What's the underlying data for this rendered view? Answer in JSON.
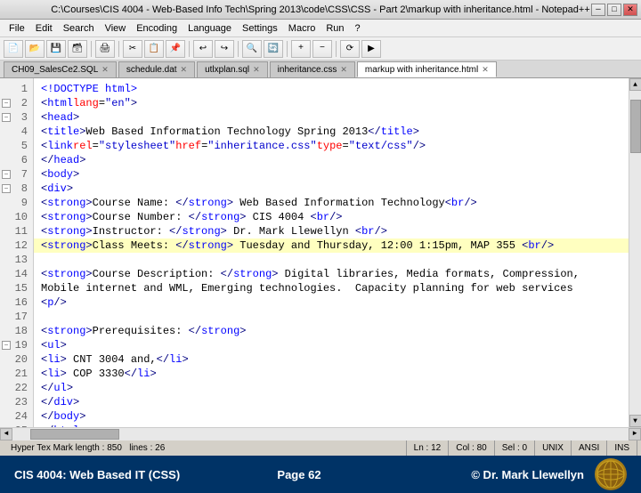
{
  "titleBar": {
    "text": "C:\\Courses\\CIS 4004 - Web-Based Info Tech\\Spring 2013\\code\\CSS\\CSS - Part 2\\markup with inheritance.html - Notepad++",
    "closeBtn": "✕",
    "maxBtn": "□",
    "minBtn": "─"
  },
  "menuBar": {
    "items": [
      "File",
      "Edit",
      "Search",
      "View",
      "Encoding",
      "Language",
      "Settings",
      "Macro",
      "Run",
      "?"
    ]
  },
  "tabs": [
    {
      "label": "CH09_SalesCe2.SQL",
      "active": false
    },
    {
      "label": "schedule.dat",
      "active": false
    },
    {
      "label": "utlxplan.sql",
      "active": false
    },
    {
      "label": "inheritance.css",
      "active": false
    },
    {
      "label": "markup with inheritance.html",
      "active": true
    }
  ],
  "lines": [
    {
      "num": 1,
      "indent": 0,
      "content": "<!DOCTYPE html>",
      "fold": false,
      "highlight": false
    },
    {
      "num": 2,
      "indent": 0,
      "content": "<html lang=\"en\">",
      "fold": true,
      "highlight": false
    },
    {
      "num": 3,
      "indent": 1,
      "content": "<head>",
      "fold": true,
      "highlight": false
    },
    {
      "num": 4,
      "indent": 2,
      "content": "<title>Web Based Information Technology Spring 2013</title>",
      "fold": false,
      "highlight": false
    },
    {
      "num": 5,
      "indent": 2,
      "content": "<link rel=\"stylesheet\" href=\"inheritance.css\" type=\"text/css\"  />",
      "fold": false,
      "highlight": false
    },
    {
      "num": 6,
      "indent": 1,
      "content": "</head>",
      "fold": false,
      "highlight": false
    },
    {
      "num": 7,
      "indent": 1,
      "content": "<body>",
      "fold": true,
      "highlight": false
    },
    {
      "num": 8,
      "indent": 2,
      "content": "<div>",
      "fold": true,
      "highlight": false
    },
    {
      "num": 9,
      "indent": 3,
      "content": "<strong>Course Name: </strong> Web Based Information Technology<br />",
      "fold": false,
      "highlight": false
    },
    {
      "num": 10,
      "indent": 3,
      "content": "<strong>Course Number: </strong> CIS 4004 <br />",
      "fold": false,
      "highlight": false
    },
    {
      "num": 11,
      "indent": 3,
      "content": "<strong>Instructor: </strong> Dr. Mark Llewellyn <br />",
      "fold": false,
      "highlight": false
    },
    {
      "num": 12,
      "indent": 3,
      "content": "<strong>Class Meets: </strong> Tuesday and Thursday, 12:00 1:15pm, MAP 355 <br />",
      "fold": false,
      "highlight": true
    },
    {
      "num": 13,
      "indent": 3,
      "content": "",
      "fold": false,
      "highlight": false
    },
    {
      "num": 14,
      "indent": 3,
      "content": "<strong>Course Description: </strong> Digital libraries, Media formats, Compression,",
      "fold": false,
      "highlight": false
    },
    {
      "num": 15,
      "indent": 3,
      "content": "Mobile internet and WML, Emerging technologies.  Capacity planning for web services",
      "fold": false,
      "highlight": false
    },
    {
      "num": 16,
      "indent": 3,
      "content": "<p />",
      "fold": false,
      "highlight": false
    },
    {
      "num": 17,
      "indent": 3,
      "content": "",
      "fold": false,
      "highlight": false
    },
    {
      "num": 18,
      "indent": 3,
      "content": "<strong>Prerequisites: </strong>",
      "fold": false,
      "highlight": false
    },
    {
      "num": 19,
      "indent": 3,
      "content": "<ul>",
      "fold": true,
      "highlight": false
    },
    {
      "num": 20,
      "indent": 4,
      "content": "<li> CNT 3004 and,</li>",
      "fold": false,
      "highlight": false
    },
    {
      "num": 21,
      "indent": 4,
      "content": "<li> COP 3330</li>",
      "fold": false,
      "highlight": false
    },
    {
      "num": 22,
      "indent": 3,
      "content": "</ul>",
      "fold": false,
      "highlight": false
    },
    {
      "num": 23,
      "indent": 2,
      "content": "</div>",
      "fold": false,
      "highlight": false
    },
    {
      "num": 24,
      "indent": 1,
      "content": "</body>",
      "fold": false,
      "highlight": false
    },
    {
      "num": 25,
      "indent": 0,
      "content": "</html>",
      "fold": false,
      "highlight": false
    }
  ],
  "statusBar": {
    "hyper": "Hyper Tex Mark length : 850",
    "lines": "lines : 26",
    "ln": "Ln : 12",
    "col": "Col : 80",
    "sel": "Sel : 0",
    "unix": "UNIX",
    "ansi": "ANSI",
    "ins": "INS"
  },
  "footer": {
    "left": "CIS 4004: Web Based IT (CSS)",
    "center": "Page 62",
    "right": "© Dr. Mark Llewellyn"
  }
}
